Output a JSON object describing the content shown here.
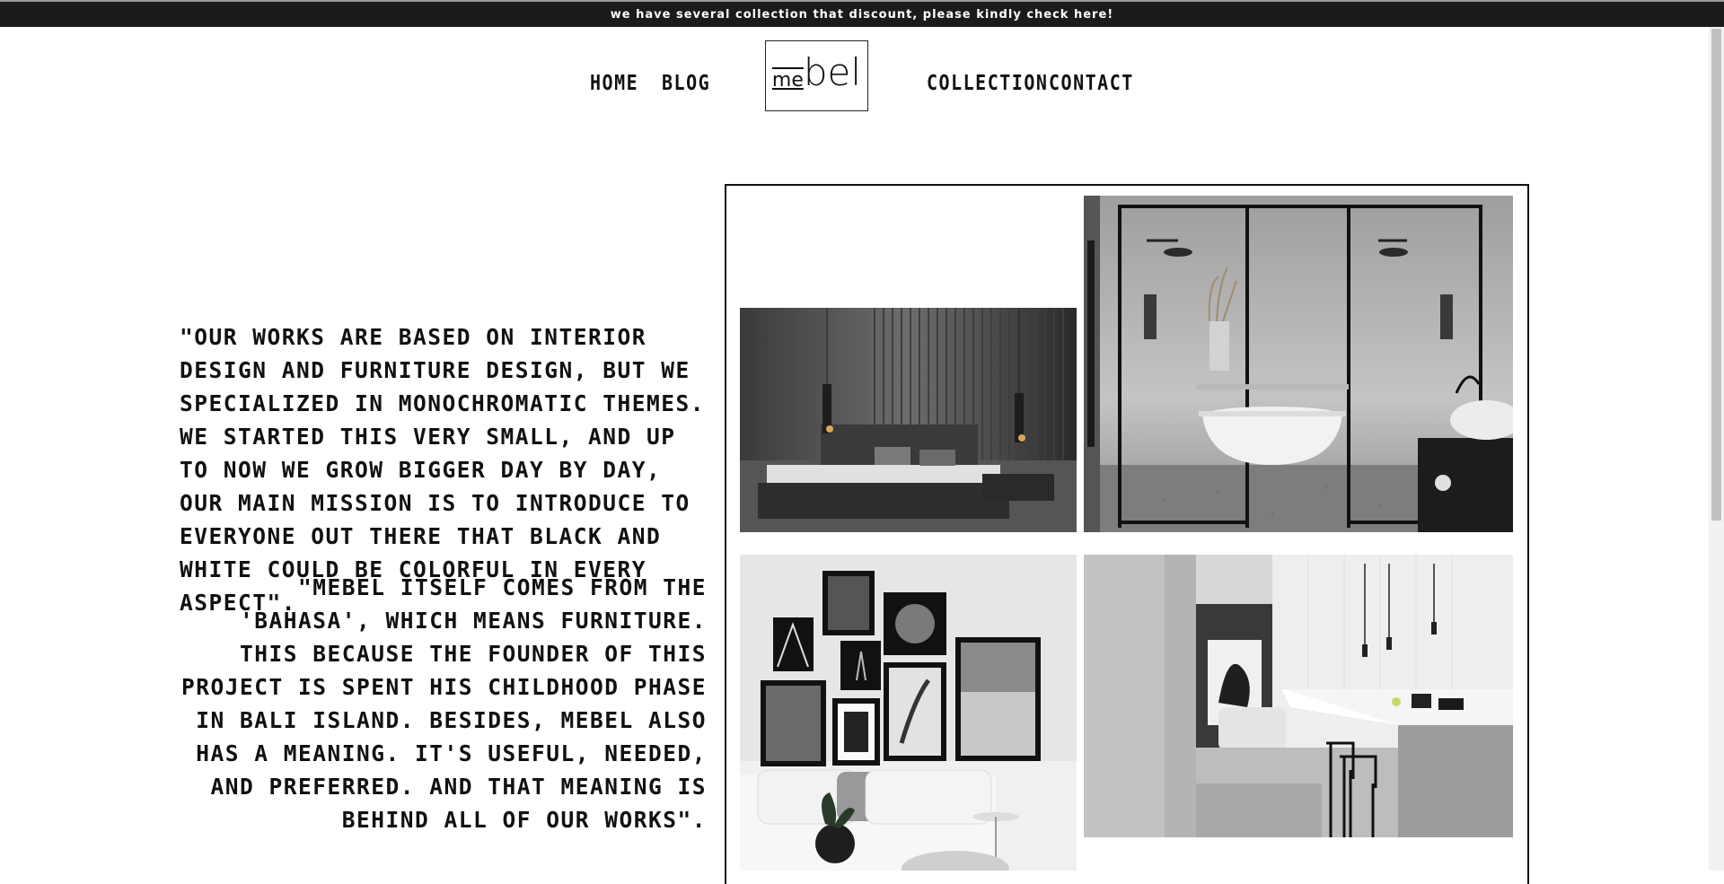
{
  "announcement": "we have several collection that discount, please kindly check here!",
  "nav": {
    "home": "HOME",
    "blog": "BLOG",
    "collection": "COLLECTION",
    "contact": "CONTACT"
  },
  "logo": {
    "part_me": "me",
    "part_bel": "bel"
  },
  "about": {
    "quote_1": "\"OUR WORKS ARE BASED ON INTERIOR DESIGN AND FURNITURE DESIGN, BUT WE SPECIALIZED IN MONOCHROMATIC THEMES. WE STARTED THIS VERY SMALL, AND UP TO NOW WE GROW BIGGER DAY BY DAY, OUR MAIN MISSION IS TO INTRODUCE TO EVERYONE OUT THERE THAT BLACK AND WHITE COULD BE COLORFUL IN EVERY ASPECT\".",
    "quote_2": "\"MEBEL ITSELF COMES FROM THE 'BAHASA', WHICH MEANS FURNITURE. THIS BECAUSE THE FOUNDER OF THIS PROJECT IS SPENT HIS CHILDHOOD PHASE IN BALI ISLAND. BESIDES, MEBEL ALSO HAS A MEANING. IT'S USEFUL, NEEDED, AND PREFERRED. AND THAT MEANING IS BEHIND ALL OF OUR WORKS\"."
  },
  "gallery": {
    "photos": [
      "bedroom-photo",
      "bathroom-photo",
      "gallery-wall-photo",
      "kitchen-photo"
    ]
  },
  "colors": {
    "topbar_bg": "#1b1b1b",
    "text": "#111111",
    "background": "#ffffff"
  }
}
